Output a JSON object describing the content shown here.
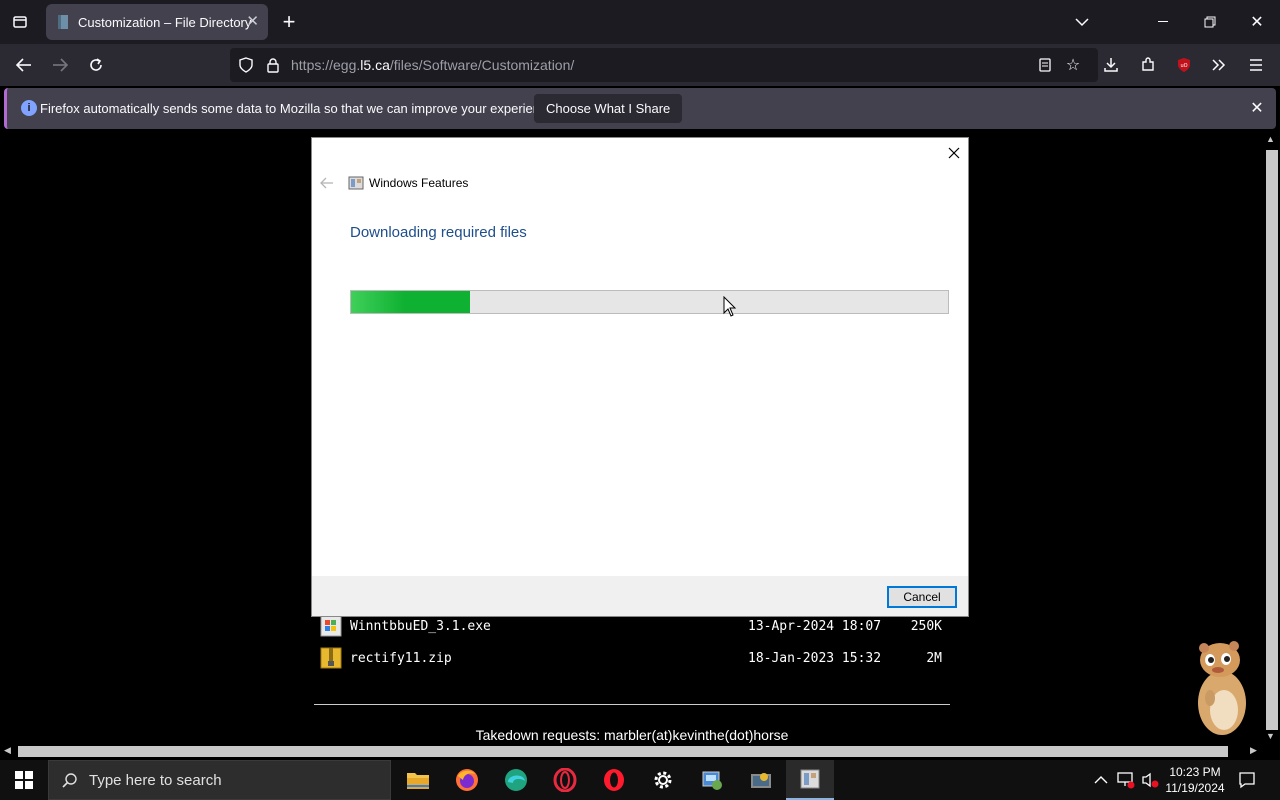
{
  "browser": {
    "tab_title": "Customization – File Directory",
    "url_prefix": "https://egg.",
    "url_host": "l5.ca",
    "url_path": "/files/Software/Customization/",
    "notification": "Firefox automatically sends some data to Mozilla so that we can improve your experience.",
    "notification_button": "Choose What I Share"
  },
  "dialog": {
    "title": "Windows Features",
    "heading": "Downloading required files",
    "progress_percent": 20,
    "cancel_label": "Cancel"
  },
  "files": [
    {
      "name": "WinntbbuED_3.1.exe",
      "date": "13-Apr-2024 18:07",
      "size": "250K",
      "icon": "exe-icon"
    },
    {
      "name": "rectify11.zip",
      "date": "18-Jan-2023 15:32",
      "size": "2M",
      "icon": "zip-icon"
    }
  ],
  "footer": {
    "takedown": "Takedown requests: marbler(at)kevinthe(dot)horse"
  },
  "taskbar": {
    "search_placeholder": "Type here to search",
    "time": "10:23 PM",
    "date": "11/19/2024"
  },
  "colors": {
    "accent": "#0078d7",
    "progress": "#0fb132",
    "heading": "#1e4e8c"
  }
}
